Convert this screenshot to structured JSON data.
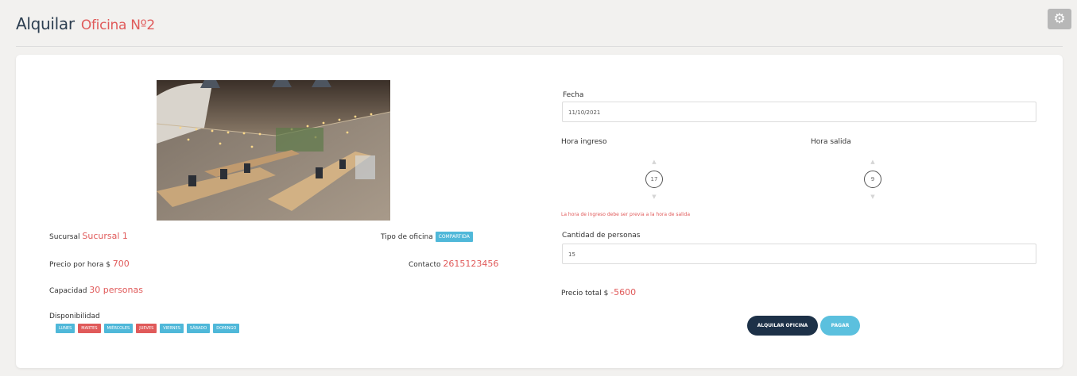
{
  "header": {
    "title": "Alquilar",
    "subtitle": "Oficina Nº2",
    "settings_icon": "gear-icon"
  },
  "office": {
    "photo_alt": "coworking",
    "sucursal_label": "Sucursal",
    "sucursal_value": "Sucursal 1",
    "tipo_label": "Tipo de oficina",
    "tipo_value": "COMPARTIDA",
    "precio_label": "Precio por hora $",
    "precio_value": "700",
    "contacto_label": "Contacto",
    "contacto_value": "2615123456",
    "capacidad_label": "Capacidad",
    "capacidad_value": "30 personas",
    "disponibilidad_label": "Disponibilidad",
    "days": [
      {
        "label": "LUNES",
        "available": true
      },
      {
        "label": "MARTES",
        "available": false
      },
      {
        "label": "MIÉRCOLES",
        "available": true
      },
      {
        "label": "JUEVES",
        "available": false
      },
      {
        "label": "VIERNES",
        "available": true
      },
      {
        "label": "SÁBADO",
        "available": true
      },
      {
        "label": "DOMINGO",
        "available": true
      }
    ]
  },
  "form": {
    "fecha_label": "Fecha",
    "fecha_value": "11/10/2021",
    "hora_ingreso_label": "Hora ingreso",
    "hora_ingreso_value": "17",
    "hora_salida_label": "Hora salida",
    "hora_salida_value": "9",
    "error_text": "La hora de ingreso debe ser previa a la hora de salida",
    "cantidad_label": "Cantidad de personas",
    "cantidad_value": "15",
    "precio_total_label": "Precio total $",
    "precio_total_value": "-5600",
    "alquilar_button": "ALQUILAR OFICINA",
    "pagar_button": "PAGAR"
  },
  "colors": {
    "accent_red": "#e05a5a",
    "accent_blue": "#4fb8d9",
    "dark_button": "#1d3148"
  }
}
